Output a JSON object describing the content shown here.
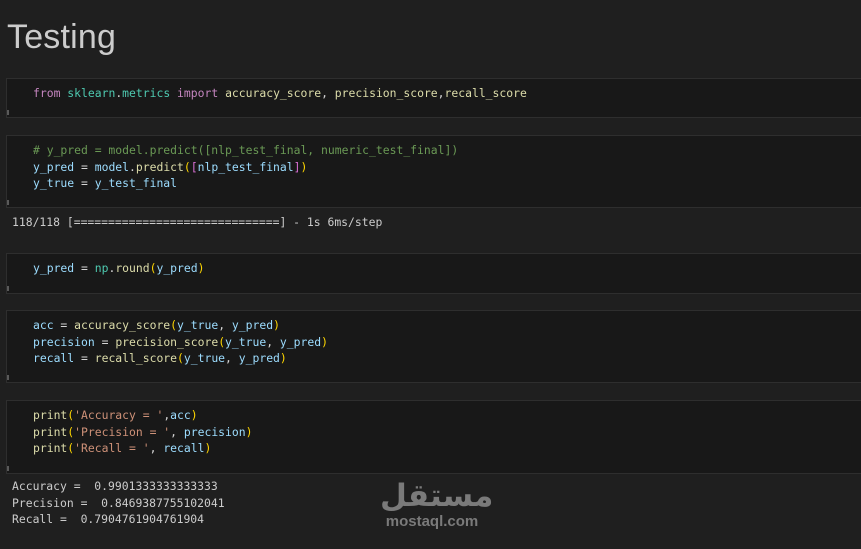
{
  "heading": "Testing",
  "cells": [
    {
      "lines": [
        [
          [
            "kw",
            "from"
          ],
          [
            "op",
            " "
          ],
          [
            "mod",
            "sklearn"
          ],
          [
            "op",
            "."
          ],
          [
            "mod",
            "metrics"
          ],
          [
            "op",
            " "
          ],
          [
            "kw",
            "import"
          ],
          [
            "op",
            " "
          ],
          [
            "fn",
            "accuracy_score"
          ],
          [
            "op",
            ", "
          ],
          [
            "fn",
            "precision_score"
          ],
          [
            "op",
            ","
          ],
          [
            "fn",
            "recall_score"
          ]
        ]
      ]
    },
    {
      "lines": [
        [
          [
            "cm",
            "# y_pred = model.predict([nlp_test_final, numeric_test_final])"
          ]
        ],
        [
          [
            "var",
            "y_pred"
          ],
          [
            "op",
            " = "
          ],
          [
            "var",
            "model"
          ],
          [
            "op",
            "."
          ],
          [
            "fn",
            "predict"
          ],
          [
            "p1",
            "("
          ],
          [
            "p2",
            "["
          ],
          [
            "var",
            "nlp_test_final"
          ],
          [
            "p2",
            "]"
          ],
          [
            "p1",
            ")"
          ]
        ],
        [
          [
            "var",
            "y_true"
          ],
          [
            "op",
            " = "
          ],
          [
            "var",
            "y_test_final"
          ]
        ]
      ],
      "output": "118/118 [==============================] - 1s 6ms/step"
    },
    {
      "lines": [
        [
          [
            "var",
            "y_pred"
          ],
          [
            "op",
            " = "
          ],
          [
            "mod",
            "np"
          ],
          [
            "op",
            "."
          ],
          [
            "fn",
            "round"
          ],
          [
            "p1",
            "("
          ],
          [
            "var",
            "y_pred"
          ],
          [
            "p1",
            ")"
          ]
        ]
      ]
    },
    {
      "lines": [
        [
          [
            "var",
            "acc"
          ],
          [
            "op",
            " = "
          ],
          [
            "fn",
            "accuracy_score"
          ],
          [
            "p1",
            "("
          ],
          [
            "var",
            "y_true"
          ],
          [
            "op",
            ", "
          ],
          [
            "var",
            "y_pred"
          ],
          [
            "p1",
            ")"
          ]
        ],
        [
          [
            "var",
            "precision"
          ],
          [
            "op",
            " = "
          ],
          [
            "fn",
            "precision_score"
          ],
          [
            "p1",
            "("
          ],
          [
            "var",
            "y_true"
          ],
          [
            "op",
            ", "
          ],
          [
            "var",
            "y_pred"
          ],
          [
            "p1",
            ")"
          ]
        ],
        [
          [
            "var",
            "recall"
          ],
          [
            "op",
            " = "
          ],
          [
            "fn",
            "recall_score"
          ],
          [
            "p1",
            "("
          ],
          [
            "var",
            "y_true"
          ],
          [
            "op",
            ", "
          ],
          [
            "var",
            "y_pred"
          ],
          [
            "p1",
            ")"
          ]
        ]
      ]
    },
    {
      "lines": [
        [
          [
            "fn",
            "print"
          ],
          [
            "p1",
            "("
          ],
          [
            "str",
            "'Accuracy = '"
          ],
          [
            "op",
            ","
          ],
          [
            "var",
            "acc"
          ],
          [
            "p1",
            ")"
          ]
        ],
        [
          [
            "fn",
            "print"
          ],
          [
            "p1",
            "("
          ],
          [
            "str",
            "'Precision = '"
          ],
          [
            "op",
            ", "
          ],
          [
            "var",
            "precision"
          ],
          [
            "p1",
            ")"
          ]
        ],
        [
          [
            "fn",
            "print"
          ],
          [
            "p1",
            "("
          ],
          [
            "str",
            "'Recall = '"
          ],
          [
            "op",
            ", "
          ],
          [
            "var",
            "recall"
          ],
          [
            "p1",
            ")"
          ]
        ]
      ],
      "output": "Accuracy =  0.9901333333333333\nPrecision =  0.8469387755102041\nRecall =  0.7904761904761904"
    }
  ],
  "watermark": {
    "logo": "مستقل",
    "url": "mostaql.com"
  }
}
